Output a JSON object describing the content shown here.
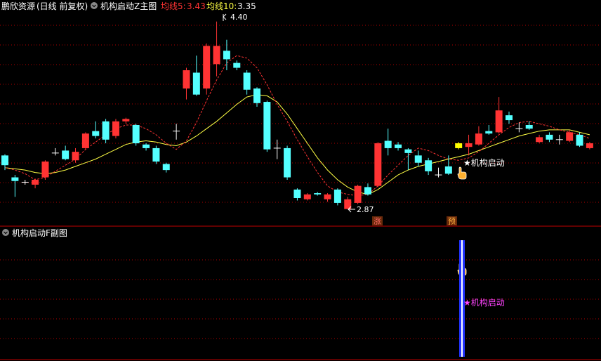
{
  "main_panel": {
    "stock_name": "鹏欣资源",
    "period": "(日线 前复权)",
    "indicator": "机构启动Z主图",
    "ma5_label": "均线5:",
    "ma5_value": "3.43",
    "ma10_label": "均线10:",
    "ma10_value": "3.35",
    "high_label": "4.40",
    "low_label": "2.87",
    "signal_label": "★机构启动",
    "badge_zhang": "涨",
    "badge_yu": "预"
  },
  "sub_panel": {
    "indicator": "机构启动F副图",
    "signal_label": "★机构启动"
  },
  "colors": {
    "up": "#ff3333",
    "down": "#54ffff",
    "ma5": "#ff3333",
    "ma10": "#ffff44",
    "grid": "#b00000",
    "panel_border": "#c00000",
    "signal_text_main": "#ffffff",
    "signal_text_sub": "#ff44ff",
    "bar_blue": "#2233ff",
    "bar_white": "#ffffff",
    "highlight_yellow": "#ffff00",
    "header_text": "#ffffff",
    "ma5_text": "#ff3333",
    "ma10_text": "#ffff44",
    "badge_bg": "#6a2a0a",
    "badge_zhang_text": "#ff6666",
    "badge_yu_text": "#ffb040"
  },
  "icons": {
    "collapse": "circle-chevron-down-icon",
    "cursor": "hand-pointer-icon"
  },
  "chart_data": {
    "type": "candlestick",
    "ylim": [
      2.8,
      4.45
    ],
    "candles": [
      {
        "o": 3.22,
        "c": 3.3,
        "h": 3.31,
        "l": 3.18,
        "dir": "down"
      },
      {
        "o": 3.12,
        "c": 3.09,
        "h": 3.14,
        "l": 2.96,
        "dir": "down"
      },
      {
        "o": 3.08,
        "c": 3.08,
        "h": 3.1,
        "l": 3.06,
        "dir": "doji"
      },
      {
        "o": 3.06,
        "c": 3.1,
        "h": 3.11,
        "l": 3.03,
        "dir": "up"
      },
      {
        "o": 3.12,
        "c": 3.25,
        "h": 3.26,
        "l": 3.1,
        "dir": "up"
      },
      {
        "o": 3.32,
        "c": 3.32,
        "h": 3.36,
        "l": 3.3,
        "dir": "doji"
      },
      {
        "o": 3.27,
        "c": 3.34,
        "h": 3.38,
        "l": 3.26,
        "dir": "down"
      },
      {
        "o": 3.26,
        "c": 3.33,
        "h": 3.36,
        "l": 3.24,
        "dir": "up"
      },
      {
        "o": 3.36,
        "c": 3.48,
        "h": 3.49,
        "l": 3.35,
        "dir": "up"
      },
      {
        "o": 3.46,
        "c": 3.5,
        "h": 3.58,
        "l": 3.44,
        "dir": "down"
      },
      {
        "o": 3.43,
        "c": 3.58,
        "h": 3.6,
        "l": 3.4,
        "dir": "down"
      },
      {
        "o": 3.46,
        "c": 3.58,
        "h": 3.6,
        "l": 3.44,
        "dir": "up"
      },
      {
        "o": 3.58,
        "c": 3.6,
        "h": 3.61,
        "l": 3.56,
        "dir": "up"
      },
      {
        "o": 3.4,
        "c": 3.55,
        "h": 3.56,
        "l": 3.38,
        "dir": "down"
      },
      {
        "o": 3.36,
        "c": 3.39,
        "h": 3.4,
        "l": 3.34,
        "dir": "down"
      },
      {
        "o": 3.25,
        "c": 3.36,
        "h": 3.38,
        "l": 3.23,
        "dir": "down"
      },
      {
        "o": 3.18,
        "c": 3.23,
        "h": 3.24,
        "l": 3.16,
        "dir": "down"
      },
      {
        "o": 3.5,
        "c": 3.5,
        "h": 3.56,
        "l": 3.43,
        "dir": "doji"
      },
      {
        "o": 3.85,
        "c": 4.0,
        "h": 4.02,
        "l": 3.76,
        "dir": "up"
      },
      {
        "o": 3.8,
        "c": 3.98,
        "h": 4.12,
        "l": 3.79,
        "dir": "down"
      },
      {
        "o": 3.85,
        "c": 4.2,
        "h": 4.22,
        "l": 3.8,
        "dir": "up"
      },
      {
        "o": 4.05,
        "c": 4.2,
        "h": 4.4,
        "l": 3.95,
        "dir": "up"
      },
      {
        "o": 4.09,
        "c": 4.16,
        "h": 4.25,
        "l": 4.0,
        "dir": "down"
      },
      {
        "o": 4.02,
        "c": 4.06,
        "h": 4.08,
        "l": 4.0,
        "dir": "down"
      },
      {
        "o": 3.84,
        "c": 3.98,
        "h": 4.0,
        "l": 3.8,
        "dir": "down"
      },
      {
        "o": 3.73,
        "c": 3.85,
        "h": 3.86,
        "l": 3.7,
        "dir": "down"
      },
      {
        "o": 3.35,
        "c": 3.74,
        "h": 3.75,
        "l": 3.33,
        "dir": "down"
      },
      {
        "o": 3.36,
        "c": 3.36,
        "h": 3.43,
        "l": 3.27,
        "dir": "doji"
      },
      {
        "o": 3.12,
        "c": 3.36,
        "h": 3.38,
        "l": 3.1,
        "dir": "down"
      },
      {
        "o": 2.95,
        "c": 3.02,
        "h": 3.03,
        "l": 2.93,
        "dir": "down"
      },
      {
        "o": 2.94,
        "c": 2.98,
        "h": 2.99,
        "l": 2.93,
        "dir": "up"
      },
      {
        "o": 2.98,
        "c": 2.99,
        "h": 3.0,
        "l": 2.97,
        "dir": "down"
      },
      {
        "o": 2.94,
        "c": 2.98,
        "h": 2.99,
        "l": 2.92,
        "dir": "up"
      },
      {
        "o": 2.91,
        "c": 3.02,
        "h": 3.03,
        "l": 2.89,
        "dir": "down"
      },
      {
        "o": 2.86,
        "c": 2.94,
        "h": 2.96,
        "l": 2.87,
        "dir": "up"
      },
      {
        "o": 2.91,
        "c": 3.05,
        "h": 3.06,
        "l": 2.9,
        "dir": "up"
      },
      {
        "o": 2.98,
        "c": 3.04,
        "h": 3.07,
        "l": 2.97,
        "dir": "down"
      },
      {
        "o": 3.05,
        "c": 3.4,
        "h": 3.41,
        "l": 3.04,
        "dir": "up"
      },
      {
        "o": 3.36,
        "c": 3.42,
        "h": 3.52,
        "l": 3.3,
        "dir": "down"
      },
      {
        "o": 3.36,
        "c": 3.39,
        "h": 3.41,
        "l": 3.34,
        "dir": "down"
      },
      {
        "o": 3.32,
        "c": 3.35,
        "h": 3.36,
        "l": 3.18,
        "dir": "down"
      },
      {
        "o": 3.24,
        "c": 3.3,
        "h": 3.34,
        "l": 3.21,
        "dir": "down"
      },
      {
        "o": 3.17,
        "c": 3.26,
        "h": 3.28,
        "l": 3.14,
        "dir": "down"
      },
      {
        "o": 3.14,
        "c": 3.14,
        "h": 3.2,
        "l": 3.12,
        "dir": "doji"
      },
      {
        "o": 3.15,
        "c": 3.21,
        "h": 3.3,
        "l": 3.14,
        "dir": "down"
      },
      {
        "o": 3.36,
        "c": 3.4,
        "h": 3.41,
        "l": 3.35,
        "dir": "yellow"
      },
      {
        "o": 3.37,
        "c": 3.4,
        "h": 3.47,
        "l": 3.3,
        "dir": "up"
      },
      {
        "o": 3.39,
        "c": 3.48,
        "h": 3.54,
        "l": 3.38,
        "dir": "up"
      },
      {
        "o": 3.48,
        "c": 3.5,
        "h": 3.55,
        "l": 3.47,
        "dir": "down"
      },
      {
        "o": 3.49,
        "c": 3.67,
        "h": 3.78,
        "l": 3.48,
        "dir": "up"
      },
      {
        "o": 3.59,
        "c": 3.63,
        "h": 3.66,
        "l": 3.56,
        "dir": "down"
      },
      {
        "o": 3.52,
        "c": 3.52,
        "h": 3.57,
        "l": 3.49,
        "dir": "doji"
      },
      {
        "o": 3.52,
        "c": 3.55,
        "h": 3.58,
        "l": 3.51,
        "dir": "down"
      },
      {
        "o": 3.41,
        "c": 3.45,
        "h": 3.47,
        "l": 3.4,
        "dir": "up"
      },
      {
        "o": 3.43,
        "c": 3.47,
        "h": 3.49,
        "l": 3.41,
        "dir": "down"
      },
      {
        "o": 3.43,
        "c": 3.43,
        "h": 3.47,
        "l": 3.39,
        "dir": "doji"
      },
      {
        "o": 3.42,
        "c": 3.49,
        "h": 3.51,
        "l": 3.41,
        "dir": "up"
      },
      {
        "o": 3.38,
        "c": 3.47,
        "h": 3.49,
        "l": 3.37,
        "dir": "down"
      },
      {
        "o": 3.36,
        "c": 3.4,
        "h": 3.41,
        "l": 3.35,
        "dir": "up"
      }
    ],
    "ma5": [
      3.2,
      3.18,
      3.15,
      3.1,
      3.12,
      3.17,
      3.22,
      3.27,
      3.35,
      3.41,
      3.47,
      3.52,
      3.55,
      3.55,
      3.52,
      3.47,
      3.4,
      3.35,
      3.42,
      3.57,
      3.75,
      3.92,
      4.06,
      4.12,
      4.1,
      4.02,
      3.88,
      3.72,
      3.58,
      3.43,
      3.29,
      3.16,
      3.05,
      3.0,
      2.98,
      2.97,
      2.98,
      3.05,
      3.14,
      3.22,
      3.3,
      3.36,
      3.34,
      3.3,
      3.27,
      3.26,
      3.28,
      3.33,
      3.4,
      3.47,
      3.53,
      3.57,
      3.58,
      3.56,
      3.54,
      3.51,
      3.49,
      3.47,
      3.44
    ],
    "ma10": [
      3.2,
      3.19,
      3.18,
      3.16,
      3.15,
      3.16,
      3.18,
      3.21,
      3.24,
      3.27,
      3.31,
      3.35,
      3.39,
      3.41,
      3.42,
      3.41,
      3.39,
      3.38,
      3.41,
      3.46,
      3.52,
      3.58,
      3.65,
      3.72,
      3.78,
      3.8,
      3.79,
      3.74,
      3.64,
      3.52,
      3.4,
      3.28,
      3.18,
      3.1,
      3.04,
      3.0,
      2.98,
      3.02,
      3.08,
      3.14,
      3.18,
      3.21,
      3.23,
      3.25,
      3.27,
      3.29,
      3.31,
      3.34,
      3.37,
      3.4,
      3.43,
      3.46,
      3.48,
      3.5,
      3.51,
      3.51,
      3.51,
      3.49,
      3.47
    ]
  }
}
